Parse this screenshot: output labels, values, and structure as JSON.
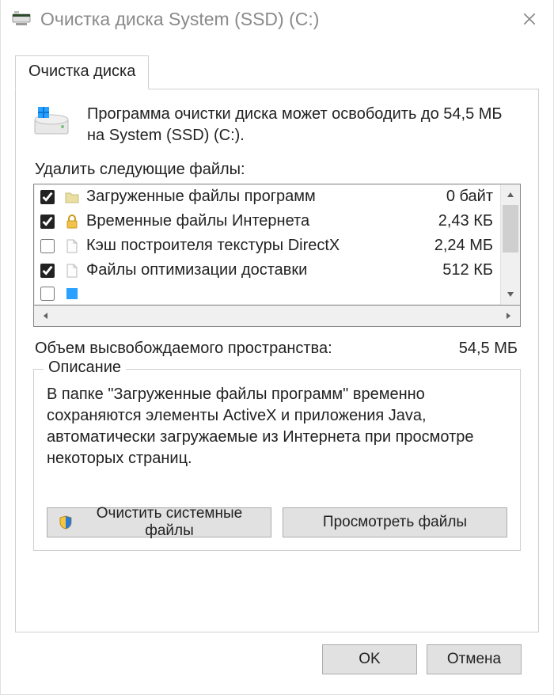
{
  "titlebar": {
    "title": "Очистка диска System (SSD) (C:)"
  },
  "tabs": {
    "cleanup": "Очистка диска"
  },
  "intro": {
    "text": "Программа очистки диска может освободить до 54,5 МБ на System (SSD) (C:)."
  },
  "labels": {
    "delete_files": "Удалить следующие файлы:",
    "free_space": "Объем высвобождаемого пространства:"
  },
  "free_space_value": "54,5 МБ",
  "file_list": [
    {
      "checked": true,
      "icon": "folder",
      "name": "Загруженные файлы программ",
      "size": "0 байт"
    },
    {
      "checked": true,
      "icon": "lock",
      "name": "Временные файлы Интернета",
      "size": "2,43 КБ"
    },
    {
      "checked": false,
      "icon": "file",
      "name": "Кэш построителя текстуры DirectX",
      "size": "2,24 МБ"
    },
    {
      "checked": true,
      "icon": "file",
      "name": "Файлы оптимизации доставки",
      "size": "512 КБ"
    }
  ],
  "description": {
    "legend": "Описание",
    "text": "В папке \"Загруженные файлы программ\" временно сохраняются элементы ActiveX и приложения Java, автоматически загружаемые из Интернета при просмотре некоторых страниц."
  },
  "buttons": {
    "clean_system": "Очистить системные файлы",
    "view_files": "Просмотреть файлы",
    "ok": "OK",
    "cancel": "Отмена"
  }
}
